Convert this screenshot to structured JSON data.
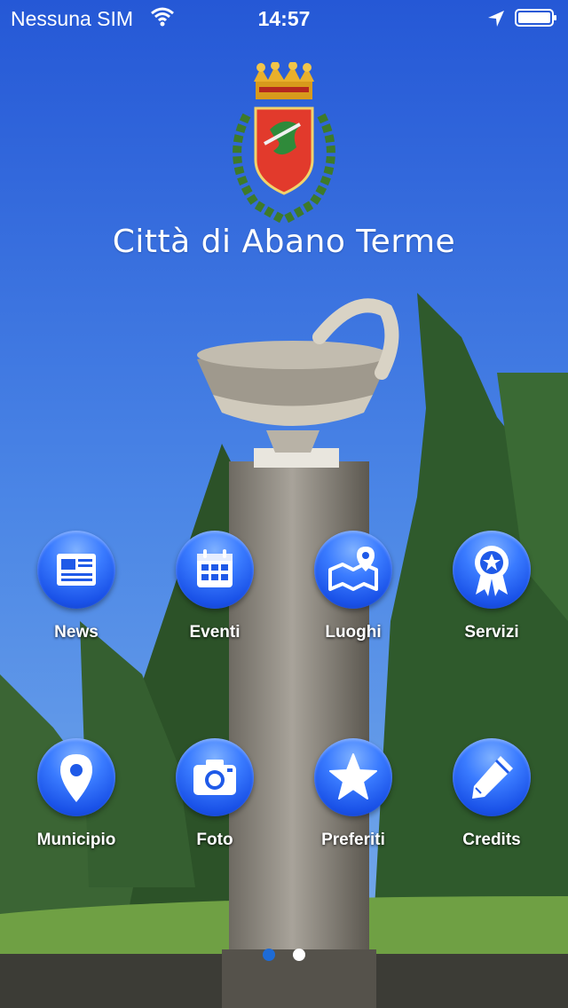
{
  "status_bar": {
    "carrier": "Nessuna SIM",
    "time": "14:57",
    "icons": [
      "wifi-icon",
      "location-arrow-icon",
      "battery-icon"
    ]
  },
  "header": {
    "title": "Città di Abano Terme",
    "emblem": "city-crest"
  },
  "menu": {
    "items": [
      {
        "label": "News",
        "icon": "newspaper-icon"
      },
      {
        "label": "Eventi",
        "icon": "calendar-icon"
      },
      {
        "label": "Luoghi",
        "icon": "map-pin-icon"
      },
      {
        "label": "Servizi",
        "icon": "badge-icon"
      },
      {
        "label": "Municipio",
        "icon": "location-pin-icon"
      },
      {
        "label": "Foto",
        "icon": "camera-icon"
      },
      {
        "label": "Preferiti",
        "icon": "star-icon"
      },
      {
        "label": "Credits",
        "icon": "pencil-icon"
      }
    ]
  },
  "pager": {
    "pages": 2,
    "current": 1
  },
  "colors": {
    "sky": "#2a63d9",
    "button_blue": "#2a66f2",
    "page_dot_active": "#1e6bd6",
    "text": "#ffffff"
  }
}
